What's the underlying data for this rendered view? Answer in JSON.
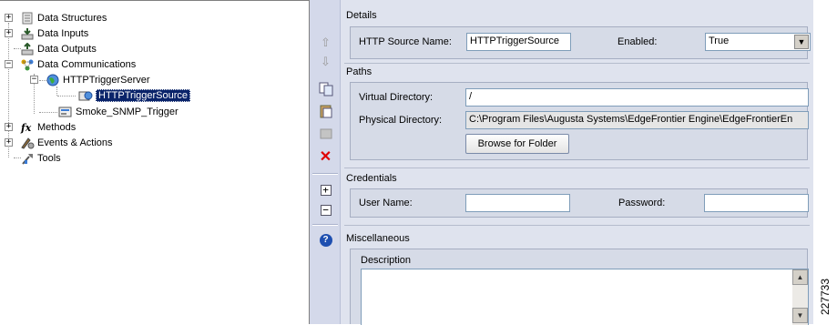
{
  "tree": {
    "items": [
      {
        "label": "Data Structures",
        "icon": "data-structures-icon"
      },
      {
        "label": "Data Inputs",
        "icon": "data-inputs-icon"
      },
      {
        "label": "Data Outputs",
        "icon": "data-outputs-icon"
      },
      {
        "label": "Data Communications",
        "icon": "data-communications-icon"
      },
      {
        "label": "HTTPTriggerServer",
        "icon": "globe-icon"
      },
      {
        "label": "HTTPTriggerSource",
        "icon": "http-source-icon"
      },
      {
        "label": "Smoke_SNMP_Trigger",
        "icon": "snmp-trigger-icon"
      },
      {
        "label": "Methods",
        "icon": "function-icon"
      },
      {
        "label": "Events & Actions",
        "icon": "events-actions-icon"
      },
      {
        "label": "Tools",
        "icon": "tools-icon"
      }
    ],
    "expand_glyphs": {
      "plus": "+",
      "minus": "−"
    }
  },
  "toolbar": {
    "icons": [
      "move-up-icon",
      "move-down-icon",
      "copy-icon",
      "paste-icon",
      "disabled-icon",
      "delete-icon",
      "expand-icon",
      "collapse-icon",
      "help-icon"
    ],
    "glyphs": {
      "up": "⇧",
      "down": "⇩",
      "delete": "✕",
      "expand": "+",
      "collapse": "−",
      "help": "?"
    }
  },
  "details": {
    "title": "Details",
    "source_name_label": "HTTP Source Name:",
    "source_name_value": "HTTPTriggerSource",
    "enabled_label": "Enabled:",
    "enabled_value": "True",
    "dropdown_glyph": "▼"
  },
  "paths": {
    "title": "Paths",
    "virtual_dir_label": "Virtual Directory:",
    "virtual_dir_value": "/",
    "physical_dir_label": "Physical Directory:",
    "physical_dir_value": "C:\\Program Files\\Augusta Systems\\EdgeFrontier Engine\\EdgeFrontierEn",
    "browse_button": "Browse for Folder"
  },
  "credentials": {
    "title": "Credentials",
    "user_label": "User Name:",
    "user_value": "",
    "password_label": "Password:",
    "password_value": ""
  },
  "misc": {
    "title": "Miscellaneous",
    "description_label": "Description",
    "description_value": "",
    "scroll_up_glyph": "▲",
    "scroll_down_glyph": "▼"
  },
  "figure_number": "227733",
  "colors": {
    "selection": "#0a246a",
    "delete": "#e00000",
    "help": "#1e4fb0"
  }
}
